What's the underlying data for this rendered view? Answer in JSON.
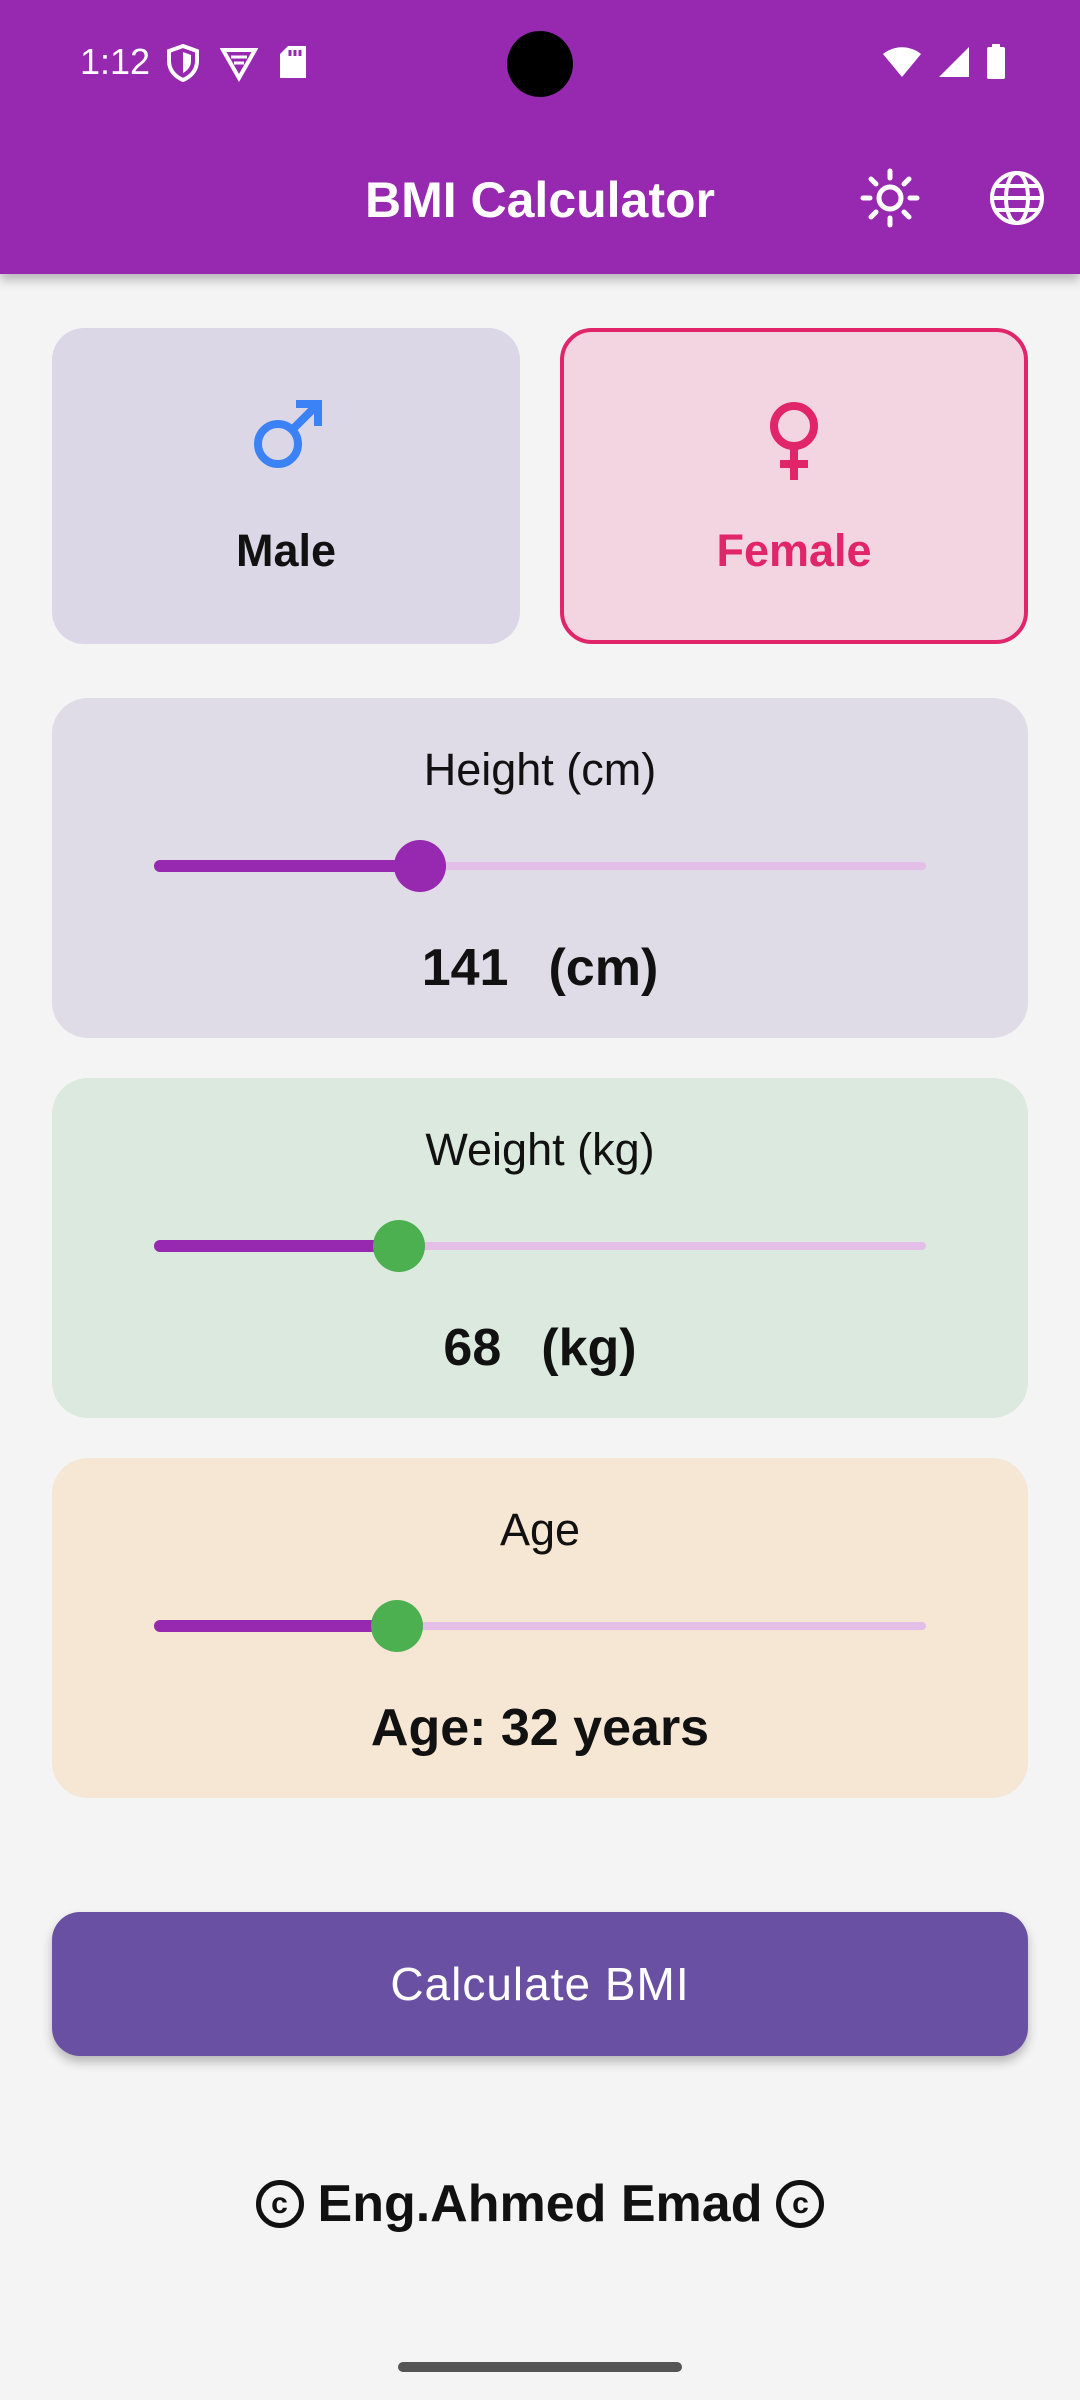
{
  "status_bar": {
    "time": "1:12",
    "left_icons": [
      "shield-icon",
      "vpn-icon",
      "sd-card-icon"
    ],
    "right_icons": [
      "wifi-icon",
      "signal-icon",
      "battery-icon"
    ]
  },
  "app_bar": {
    "title": "BMI Calculator",
    "actions": [
      "sun-icon",
      "globe-icon"
    ],
    "background_color": "#9728b0"
  },
  "gender": {
    "male": {
      "label": "Male",
      "icon": "male-icon",
      "icon_color": "#3b82f6",
      "selected": false
    },
    "female": {
      "label": "Female",
      "icon": "female-icon",
      "icon_color": "#e0256b",
      "selected": true
    }
  },
  "height": {
    "title": "Height (cm)",
    "value": "141",
    "unit": "(cm)",
    "slider_fraction": 0.345,
    "thumb_color": "#9728b0"
  },
  "weight": {
    "title": "Weight (kg)",
    "value": "68",
    "unit": "(kg)",
    "slider_fraction": 0.318,
    "thumb_color": "#4caf50"
  },
  "age": {
    "title": "Age",
    "value_text": "Age: 32 years",
    "slider_fraction": 0.315,
    "thumb_color": "#4caf50"
  },
  "calculate_button": {
    "label": "Calculate BMI",
    "color": "#6950a3"
  },
  "footer": {
    "text": "Eng.Ahmed Emad",
    "icon": "copyright-icon"
  }
}
